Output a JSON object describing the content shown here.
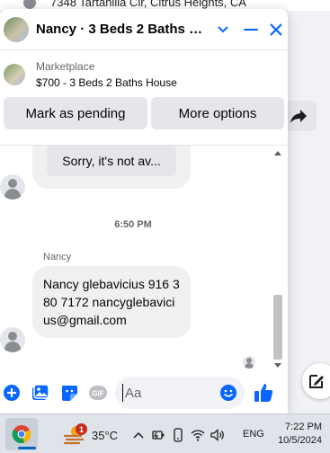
{
  "background": {
    "address": "7348 Tartanilla Cir, Citrus Heights, CA"
  },
  "chat": {
    "title": "Nancy · 3 Beds 2 Baths Ho...",
    "listing": {
      "source": "Marketplace",
      "title": "$700 - 3 Beds 2 Baths House"
    },
    "actions": {
      "pending_label": "Mark as pending",
      "more_label": "More options"
    },
    "messages": {
      "previous_preview": "Sorry, it's not av...",
      "timestamp": "6:50 PM",
      "sender": "Nancy",
      "text": "Nancy glebavicius 916 380 7172 nancyglebavicius@gmail.com"
    },
    "composer": {
      "placeholder": "Aa",
      "gif_label": "GIF"
    }
  },
  "taskbar": {
    "weather_badge": "1",
    "temperature": "35°C",
    "language": "ENG",
    "time": "7:22 PM",
    "date": "10/5/2024"
  },
  "colors": {
    "accent": "#0866ff",
    "bubble": "#f0f0f0",
    "button": "#e4e6eb"
  },
  "icons": {
    "header": [
      "chevron-down-icon",
      "minimize-icon",
      "close-icon"
    ],
    "composer": [
      "plus-icon",
      "photo-icon",
      "sticker-icon",
      "gif-icon",
      "emoji-icon",
      "like-icon"
    ],
    "tray": [
      "chevron-up-icon",
      "battery-icon",
      "phone-link-icon",
      "wifi-icon",
      "volume-icon"
    ]
  }
}
